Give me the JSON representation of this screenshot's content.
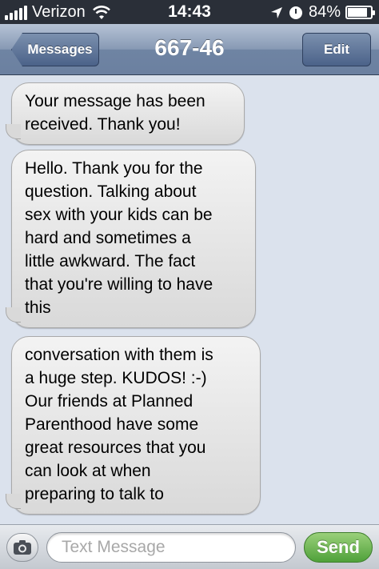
{
  "status_bar": {
    "carrier": "Verizon",
    "time": "14:43",
    "battery": "84%",
    "battery_level": 0.84
  },
  "nav": {
    "back_label": "Messages",
    "title": "667-46",
    "edit_label": "Edit"
  },
  "messages": [
    {
      "text": "Your message has been\nreceived.  Thank you!"
    },
    {
      "text": "Hello. Thank you for the\nquestion.  Talking about\nsex with your kids can be\nhard and sometimes a\nlittle awkward.  The fact\nthat you're willing to have\nthis"
    },
    {
      "text": "conversation with them is\na huge step.  KUDOS!  :-)\nOur friends at Planned\nParenthood have some\ngreat resources that you\ncan look at when\npreparing to talk to"
    }
  ],
  "compose": {
    "placeholder": "Text Message",
    "send_label": "Send"
  },
  "colors": {
    "send_green": "#4fa13a",
    "nav_blue": "#6f84a3"
  },
  "icons": [
    "signal-bars-icon",
    "wifi-icon",
    "location-arrow-icon",
    "alarm-clock-icon",
    "battery-icon",
    "camera-icon"
  ]
}
